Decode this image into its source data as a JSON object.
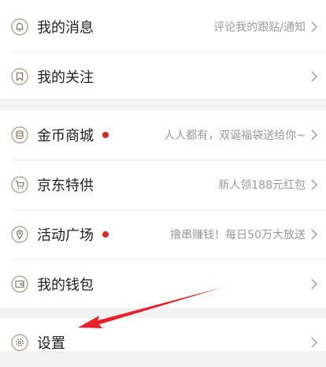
{
  "menu": {
    "items": [
      {
        "label": "我的消息",
        "desc": "评论我的跟贴/通知",
        "icon": "bell-icon"
      },
      {
        "label": "我的关注",
        "desc": "",
        "icon": "bookmark-icon"
      },
      {
        "label": "金币商城",
        "desc": "人人都有，双诞福袋送给你~",
        "icon": "coin-stack-icon",
        "dot": true
      },
      {
        "label": "京东特供",
        "desc": "新人领188元红包",
        "icon": "cart-icon"
      },
      {
        "label": "活动广场",
        "desc": "撸串赚钱！每日50万大放送",
        "icon": "location-pin-icon",
        "dot": true
      },
      {
        "label": "我的钱包",
        "desc": "",
        "icon": "wallet-icon"
      },
      {
        "label": "设置",
        "desc": "",
        "icon": "gear-icon"
      }
    ]
  },
  "colors": {
    "background": "#f2f2f2",
    "row": "#ffffff",
    "text": "#222222",
    "secondary": "#9a9a9a",
    "badge_dot": "#e0251d",
    "icon_stroke": "#b0a696",
    "annotation_arrow": "#e8212a"
  }
}
